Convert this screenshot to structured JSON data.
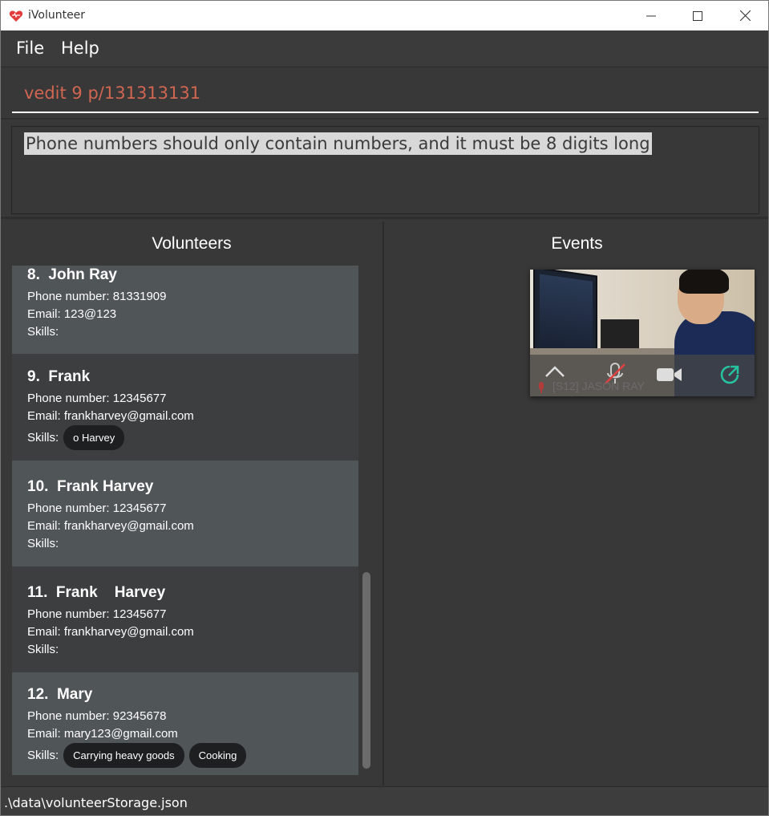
{
  "window": {
    "title": "iVolunteer",
    "icon": "heart-logo-icon"
  },
  "menu": {
    "file": "File",
    "help": "Help"
  },
  "command": {
    "value": "vedit 9 p/131313131"
  },
  "result": {
    "message": "Phone numbers should only contain numbers, and it must be 8 digits long"
  },
  "volunteers": {
    "title": "Volunteers",
    "phone_label": "Phone number: ",
    "email_label": "Email: ",
    "skills_label": "Skills:",
    "items": [
      {
        "name": "8.  John Ray",
        "phone": "Phone number: 81331909",
        "email": "Email: 123@123",
        "skills_text": "Skills:",
        "skills": []
      },
      {
        "name": "9.  Frank",
        "phone": "Phone number: 12345677",
        "email": "Email: frankharvey@gmail.com",
        "skills_text": "Skills:",
        "skills": [
          "o Harvey"
        ]
      },
      {
        "name": "10.  Frank Harvey",
        "phone": "Phone number: 12345677",
        "email": "Email: frankharvey@gmail.com",
        "skills_text": "Skills:",
        "skills": []
      },
      {
        "name": "11.  Frank    Harvey",
        "phone": "Phone number: 12345677",
        "email": "Email: frankharvey@gmail.com",
        "skills_text": "Skills:",
        "skills": []
      },
      {
        "name": "12.  Mary",
        "phone": "Phone number: 92345678",
        "email": "Email: mary123@gmail.com",
        "skills_text": "Skills:",
        "skills": [
          "Carrying heavy goods",
          "Cooking"
        ]
      }
    ]
  },
  "events": {
    "title": "Events"
  },
  "video_overlay": {
    "participant_label": "[S12] JASON RAY",
    "controls": [
      "chevron-up-icon",
      "mic-muted-icon",
      "camera-icon",
      "share-screen-icon"
    ]
  },
  "status": {
    "path": ".\\data\\volunteerStorage.json"
  },
  "colors": {
    "command_text": "#d06651",
    "card_light": "#505558",
    "card_dark": "#3c3e3f",
    "tag_bg": "#1e1f21",
    "background": "#383838"
  }
}
